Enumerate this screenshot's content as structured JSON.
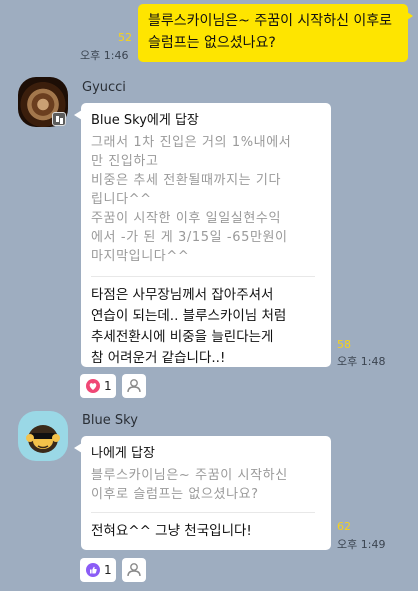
{
  "outgoing": {
    "text": "블루스카이님은~ 주꿈이 시작하신 이후로 슬럼프는 없으셨나요?",
    "unread": "52",
    "time": "오후 1:46"
  },
  "messages": [
    {
      "sender": "Gyucci",
      "reply_to": "Blue Sky에게 답장",
      "quote": "그래서 1차 진입은 거의 1%내에서\n만 진입하고\n비중은 추세 전환될때까지는 기다\n립니다^^\n주꿈이 시작한 이후 일일실현수익\n에서 -가 된 게 3/15일 -65만원이\n마지막입니다^^",
      "text": "타점은 사무장님께서 잡아주셔서\n연습이 되는데.. 블루스카이님 처럼\n 추세전환시에 비중을 늘린다는게\n참 어려운거 같습니다..!",
      "unread": "58",
      "time": "오후 1:48",
      "reaction_count": "1",
      "reaction_icon": "heart-icon"
    },
    {
      "sender": "Blue Sky",
      "reply_to": "나에게 답장",
      "quote": "블루스카이님은~ 주꿈이 시작하신\n 이후로 슬럼프는 없으셨나요?",
      "text": "전혀요^^ 그냥 천국입니다!",
      "unread": "62",
      "time": "오후 1:49",
      "reaction_count": "1",
      "reaction_icon": "like-icon"
    }
  ]
}
